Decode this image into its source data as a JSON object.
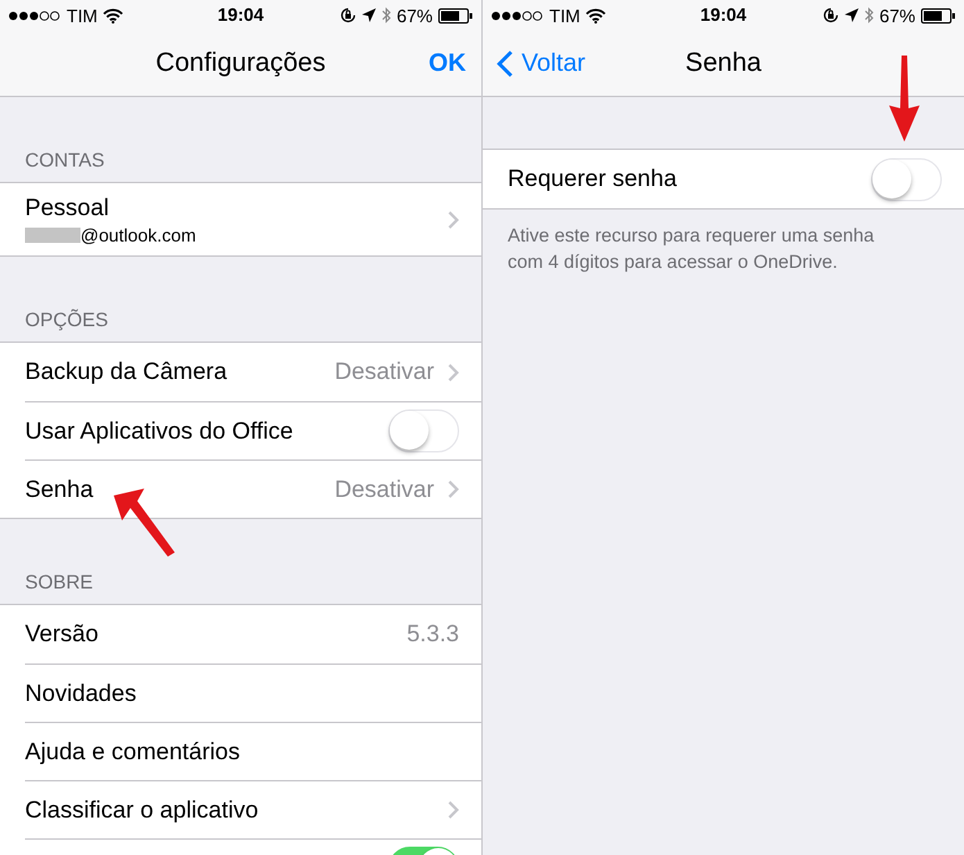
{
  "screens": [
    {
      "status_bar": {
        "carrier": "TIM",
        "time": "19:04",
        "battery": "67%"
      },
      "nav": {
        "title": "Configurações",
        "action": "OK"
      },
      "sections": [
        {
          "header": "CONTAS",
          "rows": [
            {
              "kind": "link",
              "label": "Pessoal",
              "subtitle": "@outlook.com"
            }
          ]
        },
        {
          "header": "OPÇÕES",
          "rows": [
            {
              "kind": "link",
              "label": "Backup da Câmera",
              "value": "Desativar"
            },
            {
              "kind": "toggle",
              "label": "Usar Aplicativos do Office",
              "on": false
            },
            {
              "kind": "link",
              "label": "Senha",
              "value": "Desativar"
            }
          ]
        },
        {
          "header": "SOBRE",
          "rows": [
            {
              "kind": "info",
              "label": "Versão",
              "value": "5.3.3"
            },
            {
              "kind": "info",
              "label": "Novidades"
            },
            {
              "kind": "info",
              "label": "Ajuda e comentários"
            },
            {
              "kind": "link",
              "label": "Classificar o aplicativo"
            },
            {
              "kind": "toggle",
              "on": true
            }
          ]
        }
      ]
    },
    {
      "status_bar": {
        "carrier": "TIM",
        "time": "19:04",
        "battery": "67%"
      },
      "nav": {
        "title": "Senha",
        "back": "Voltar"
      },
      "sections": [
        {
          "rows": [
            {
              "kind": "toggle",
              "label": "Requerer senha",
              "on": false
            }
          ],
          "footer": "Ative este recurso para requerer uma senha com 4 dígitos para acessar o OneDrive."
        }
      ]
    }
  ]
}
